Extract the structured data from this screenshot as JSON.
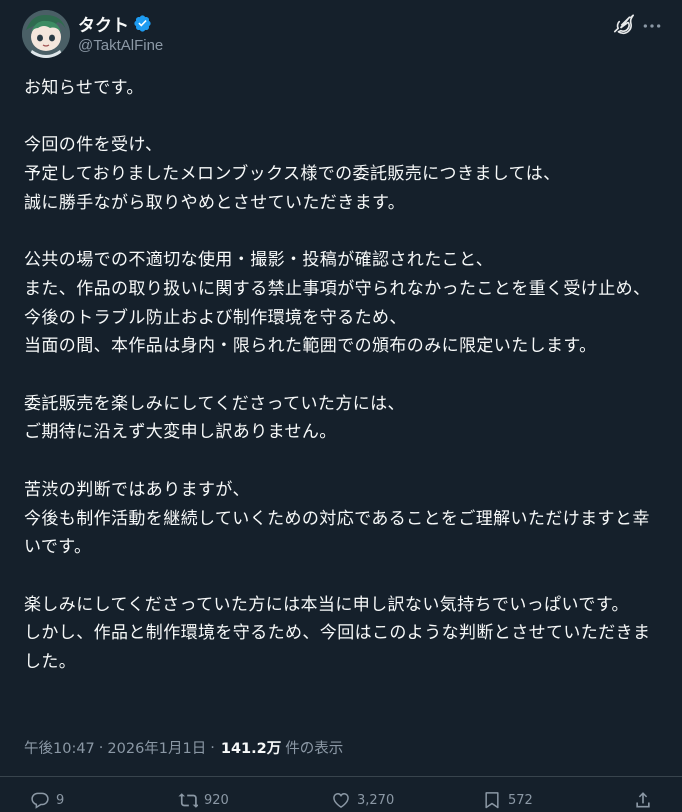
{
  "author": {
    "display_name": "タクト",
    "handle": "@TaktAlFine",
    "avatar_icon": "anime-avatar",
    "verified_icon": "verified-badge-icon",
    "verified_color": "#1d9bf0"
  },
  "header_icons": {
    "grok": "grok-icon",
    "more": "more-icon"
  },
  "tweet": {
    "text": "お知らせです。\n\n今回の件を受け、\n予定しておりましたメロンブックス様での委託販売につきましては、\n誠に勝手ながら取りやめとさせていただきます。\n\n公共の場での不適切な使用・撮影・投稿が確認されたこと、\nまた、作品の取り扱いに関する禁止事項が守られなかったことを重く受け止め、\n今後のトラブル防止および制作環境を守るため、\n当面の間、本作品は身内・限られた範囲での頒布のみに限定いたします。\n\n委託販売を楽しみにしてくださっていた方には、\nご期待に沿えず大変申し訳ありません。\n\n苦渋の判断ではありますが、\n今後も制作活動を継続していくための対応であることをご理解いただけますと幸いです。\n\n楽しみにしてくださっていた方には本当に申し訳ない気持ちでいっぱいです。\nしかし、作品と制作環境を守るため、今回はこのような判断とさせていただきました。"
  },
  "meta": {
    "time": "午後10:47",
    "separator": "·",
    "date": "2026年1月1日",
    "views_count": "141.2万",
    "views_label": "件の表示"
  },
  "actions": {
    "replies": "9",
    "reposts": "920",
    "likes": "3,270",
    "bookmarks": "572"
  },
  "colors": {
    "background": "#15202b",
    "text": "#f7f9f9",
    "secondary": "#8b98a5",
    "divider": "#38444d"
  }
}
